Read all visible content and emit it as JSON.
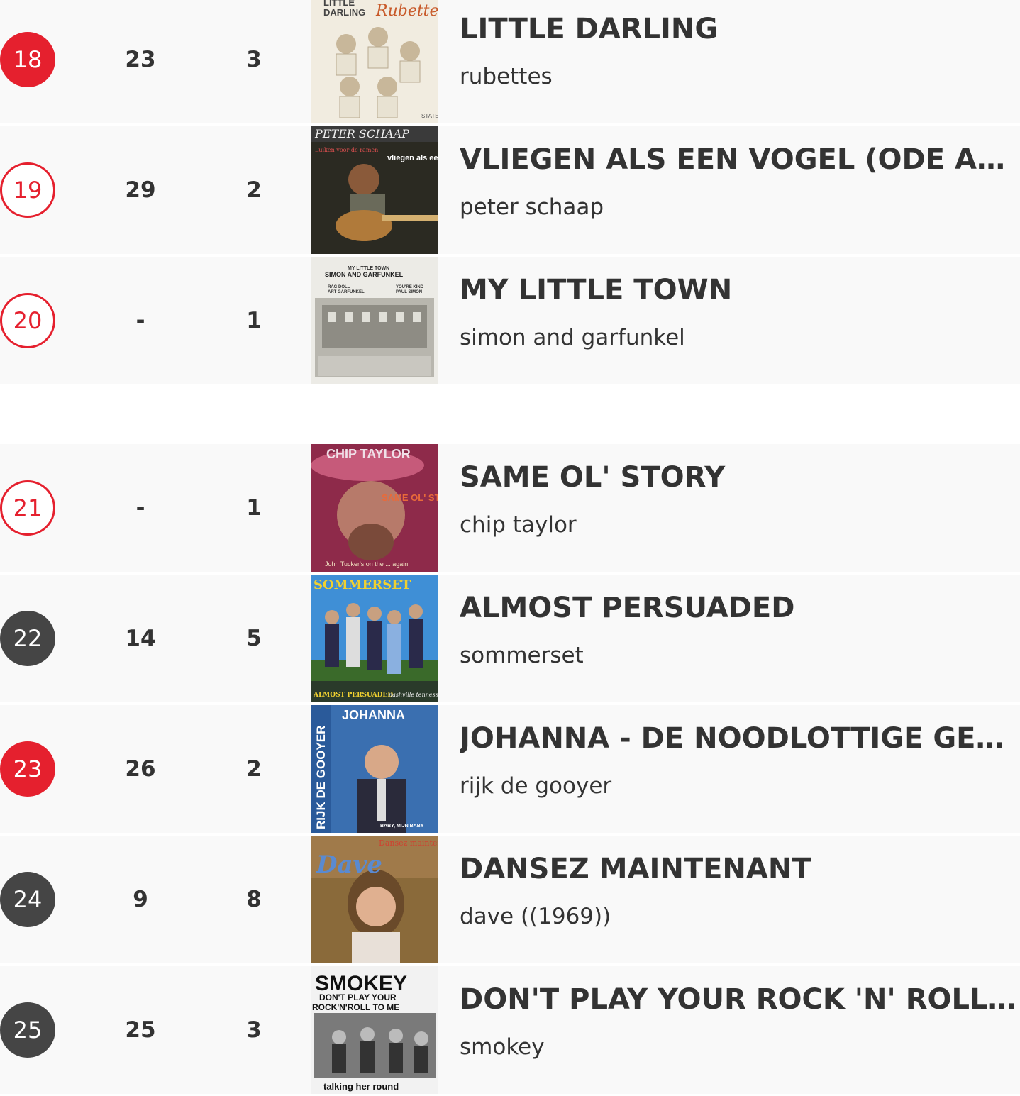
{
  "colors": {
    "accent_red": "#e5202e",
    "badge_dark": "#454545",
    "row_background": "#f9f9f9"
  },
  "entries": [
    {
      "position": "18",
      "previous": "23",
      "weeks": "3",
      "badge_style": "red",
      "title": "LITTLE DARLING",
      "artist": "rubettes",
      "cover": {
        "text_lines": [
          "LITTLE",
          "DARLING",
          "Rubettes",
          "STATE"
        ]
      }
    },
    {
      "position": "19",
      "previous": "29",
      "weeks": "2",
      "badge_style": "outline",
      "title": "VLIEGEN ALS EEN VOGEL (ODE AAN EE...",
      "artist": "peter schaap",
      "cover": {
        "text_lines": [
          "PETER SCHAAP",
          "Luiken voor de ramen",
          "vliegen als een vogel"
        ]
      }
    },
    {
      "position": "20",
      "previous": "-",
      "weeks": "1",
      "badge_style": "outline",
      "title": "MY LITTLE TOWN",
      "artist": "simon and garfunkel",
      "cover": {
        "text_lines": [
          "MY LITTLE TOWN",
          "SIMON AND GARFUNKEL",
          "RAG DOLL",
          "ART GARFUNKEL",
          "YOU'RE KIND",
          "PAUL SIMON"
        ]
      }
    },
    {
      "position": "21",
      "previous": "-",
      "weeks": "1",
      "badge_style": "outline",
      "title": "SAME OL' STORY",
      "artist": "chip taylor",
      "cover": {
        "text_lines": [
          "CHIP TAYLOR",
          "SAME OL' STORY",
          "John Tucker's on the ... again"
        ]
      }
    },
    {
      "position": "22",
      "previous": "14",
      "weeks": "5",
      "badge_style": "dark",
      "title": "ALMOST PERSUADED",
      "artist": "sommerset",
      "cover": {
        "text_lines": [
          "SOMMERSET",
          "ALMOST PERSUADED",
          "nashville tennessee"
        ]
      }
    },
    {
      "position": "23",
      "previous": "26",
      "weeks": "2",
      "badge_style": "red",
      "title": "JOHANNA - DE NOODLOTTIGE GESCHI...",
      "artist": "rijk de gooyer",
      "cover": {
        "text_lines": [
          "JOHANNA",
          "RIJK DE GOOYER",
          "BABY, MIJN BABY"
        ]
      }
    },
    {
      "position": "24",
      "previous": "9",
      "weeks": "8",
      "badge_style": "dark",
      "title": "DANSEZ MAINTENANT",
      "artist": "dave ((1969))",
      "cover": {
        "text_lines": [
          "Dave",
          "Dansez maintenant"
        ]
      }
    },
    {
      "position": "25",
      "previous": "25",
      "weeks": "3",
      "badge_style": "dark",
      "title": "DON'T PLAY YOUR ROCK 'N' ROLL TO ...",
      "artist": "smokey",
      "cover": {
        "text_lines": [
          "SMOKEY",
          "DON'T PLAY YOUR",
          "ROCK'N'ROLL TO ME",
          "talking her round"
        ]
      }
    }
  ]
}
